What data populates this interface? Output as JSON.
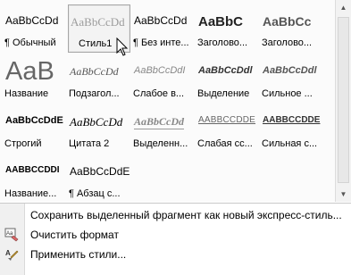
{
  "styles": [
    {
      "sample": "AaBbCcDd",
      "label": "¶ Обычный",
      "cls": "s-normal"
    },
    {
      "sample": "AaBbCcDd",
      "label": "Стиль1",
      "cls": "s-light",
      "selected": true
    },
    {
      "sample": "AaBbCcDd",
      "label": "¶ Без инте...",
      "cls": "s-normal"
    },
    {
      "sample": "AaBbC",
      "label": "Заголово...",
      "cls": "s-bold"
    },
    {
      "sample": "AaBbCc",
      "label": "Заголово...",
      "cls": "s-bold2"
    },
    {
      "sample": "AaB",
      "label": "Название",
      "cls": "s-big"
    },
    {
      "sample": "AaBbCcDd",
      "label": "Подзагол...",
      "cls": "s-italic"
    },
    {
      "sample": "AaBbCcDdI",
      "label": "Слабое в...",
      "cls": "s-italic-gray"
    },
    {
      "sample": "AaBbCcDdl",
      "label": "Выделение",
      "cls": "s-italic-bold"
    },
    {
      "sample": "AaBbCcDdl",
      "label": "Сильное ...",
      "cls": "s-italic-bold2"
    },
    {
      "sample": "AaBbCcDdE",
      "label": "Строгий",
      "cls": "s-strong"
    },
    {
      "sample": "AaBbCcDd",
      "label": "Цитата 2",
      "cls": "s-ital-serif"
    },
    {
      "sample": "AaBbCcDd",
      "label": "Выделенн...",
      "cls": "s-ital-under"
    },
    {
      "sample": "AABBCCDDE",
      "label": "Слабая сс...",
      "cls": "s-caps"
    },
    {
      "sample": "AABBCCDDE",
      "label": "Сильная с...",
      "cls": "s-caps-bold"
    },
    {
      "sample": "AABBCCDDI",
      "label": "Название...",
      "cls": "s-caps-strong"
    },
    {
      "sample": "AaBbCcDdE",
      "label": "¶ Абзац с...",
      "cls": "s-normal"
    }
  ],
  "menu": {
    "save_selection": "Сохранить выделенный фрагмент как новый экспресс-стиль...",
    "clear_format": "Очистить формат",
    "apply_styles": "Применить стили..."
  },
  "scroll": {
    "up": "▲",
    "down": "▼"
  },
  "icons": {
    "clear": "clear-format-icon",
    "apply": "apply-styles-icon",
    "cursor": "mouse-pointer-icon"
  }
}
